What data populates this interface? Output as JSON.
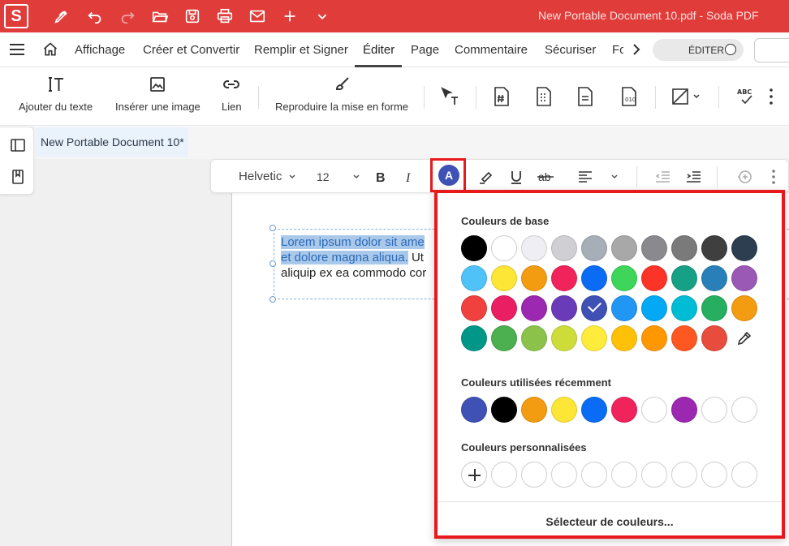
{
  "window": {
    "title": "New Portable Document 10.pdf  -  Soda PDF",
    "logo": "S"
  },
  "quick_access": [
    "pen-icon",
    "undo-icon",
    "redo-icon",
    "open-folder-icon",
    "save-icon",
    "print-icon",
    "mail-icon",
    "add-icon",
    "dropdown-icon"
  ],
  "menu": {
    "items": [
      "Affichage",
      "Créer et Convertir",
      "Remplir et Signer",
      "Éditer",
      "Page",
      "Commentaire",
      "Sécuriser",
      "Fo"
    ],
    "active": "Éditer",
    "edit_toggle": "ÉDITER"
  },
  "ribbon": {
    "add_text": "Ajouter du texte",
    "insert_image": "Insérer une image",
    "link": "Lien",
    "format_painter": "Reproduire la mise en forme"
  },
  "document": {
    "tab_label": "New Portable Document 10*",
    "line1_selected": "Lorem ipsum dolor sit ame",
    "line2_selected": "et dolore magna aliqua.",
    "line2_rest": " Ut",
    "line3": "aliquip ex ea commodo cor"
  },
  "format_toolbar": {
    "font": "Helvetic",
    "size": "12",
    "text_color_letter": "A",
    "text_color": "#3f51b5"
  },
  "color_picker": {
    "basic_title": "Couleurs de base",
    "basic_colors": [
      [
        "#000000",
        "#ffffff",
        "#eeeef4",
        "#cfcfd4",
        "#a6aeb7",
        "#a8a8a8",
        "#8a8a8e",
        "#7a7a7a",
        "#3f3f3f",
        "#2c3e50"
      ],
      [
        "#4fc3f7",
        "#fde635",
        "#f39c12",
        "#f0235a",
        "#0a6cf5",
        "#3ed65a",
        "#fb3427",
        "#16a085",
        "#2980b9",
        "#9b59b6"
      ],
      [
        "#f0413f",
        "#e91e63",
        "#9c27b0",
        "#6a3bb8",
        "#3f51b5",
        "#2196f3",
        "#03a9f4",
        "#00bcd4",
        "#27ae60",
        "#f39c12"
      ],
      [
        "#009688",
        "#4caf50",
        "#8bc34a",
        "#cddc39",
        "#ffeb3b",
        "#ffc107",
        "#ff9800",
        "#ff5722",
        "#e74c3c"
      ]
    ],
    "selected_basic": "#3f51b5",
    "eyedropper": "eyedropper-icon",
    "recent_title": "Couleurs utilisées récemment",
    "recent_colors": [
      "#3f51b5",
      "#000000",
      "#f39c12",
      "#fde635",
      "#0a6cf5",
      "#f0235a",
      "#ffffff",
      "#9c27b0",
      "#ffffff",
      "#ffffff"
    ],
    "custom_title": "Couleurs personnalisées",
    "custom_slots": 9,
    "footer": "Sélecteur de couleurs..."
  }
}
